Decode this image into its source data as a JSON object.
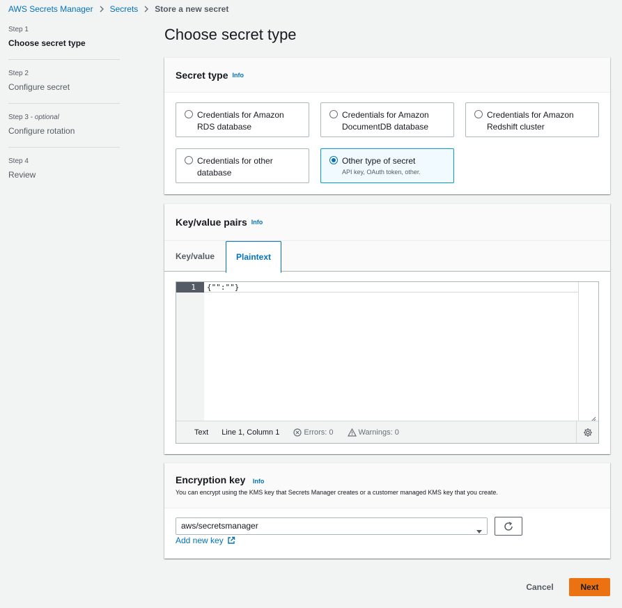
{
  "breadcrumb": {
    "items": [
      "AWS Secrets Manager",
      "Secrets",
      "Store a new secret"
    ]
  },
  "steps": [
    {
      "num": "Step 1",
      "optional": "",
      "title": "Choose secret type",
      "active": true
    },
    {
      "num": "Step 2",
      "optional": "",
      "title": "Configure secret",
      "active": false
    },
    {
      "num": "Step 3",
      "optional": "optional",
      "title": "Configure rotation",
      "active": false
    },
    {
      "num": "Step 4",
      "optional": "",
      "title": "Review",
      "active": false
    }
  ],
  "page_title": "Choose secret type",
  "secret_type": {
    "title": "Secret type",
    "info": "Info",
    "options": [
      {
        "label": "Credentials for Amazon RDS database",
        "description": "",
        "selected": false
      },
      {
        "label": "Credentials for Amazon DocumentDB database",
        "description": "",
        "selected": false
      },
      {
        "label": "Credentials for Amazon Redshift cluster",
        "description": "",
        "selected": false
      },
      {
        "label": "Credentials for other database",
        "description": "",
        "selected": false
      },
      {
        "label": "Other type of secret",
        "description": "API key, OAuth token, other.",
        "selected": true
      }
    ]
  },
  "kv": {
    "title": "Key/value pairs",
    "info": "Info",
    "tabs": [
      {
        "label": "Key/value",
        "active": false
      },
      {
        "label": "Plaintext",
        "active": true
      }
    ],
    "editor": {
      "line_number": "1",
      "code": "{\"\":\"\"}",
      "mode": "Text",
      "position": "Line 1, Column 1",
      "errors": "Errors: 0",
      "warnings": "Warnings: 0"
    }
  },
  "encryption": {
    "title": "Encryption key",
    "info": "Info",
    "description": "You can encrypt using the KMS key that Secrets Manager creates or a customer managed KMS key that you create.",
    "selected_key": "aws/secretsmanager",
    "add_key_label": "Add new key"
  },
  "footer": {
    "cancel_label": "Cancel",
    "next_label": "Next"
  },
  "colors": {
    "link": "#0073bb",
    "primary_button": "#ec7211",
    "selected_tile_bg": "#f1faff",
    "background": "#f2f3f3"
  }
}
